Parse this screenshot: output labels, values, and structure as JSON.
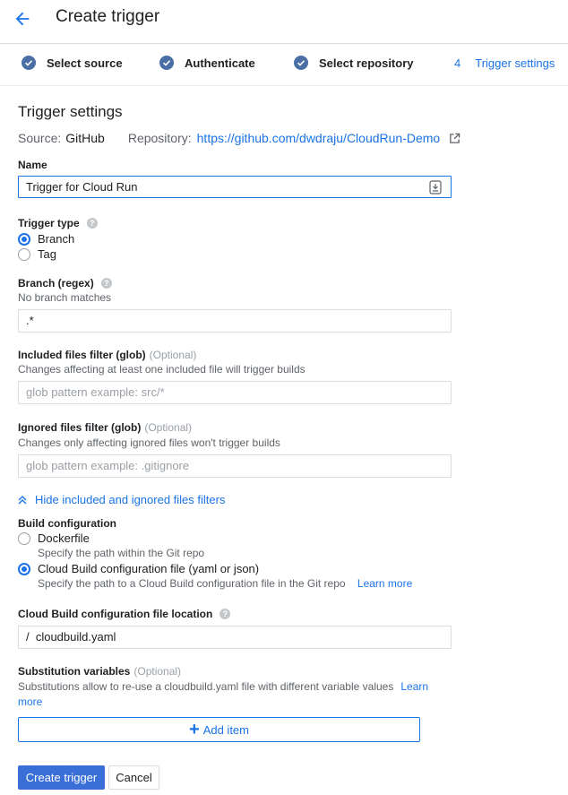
{
  "header": {
    "title": "Create trigger",
    "back_icon": "arrow-back-icon"
  },
  "stepper": {
    "steps": [
      {
        "label": "Select source",
        "state": "done"
      },
      {
        "label": "Authenticate",
        "state": "done"
      },
      {
        "label": "Select repository",
        "state": "done"
      },
      {
        "number": "4",
        "label": "Trigger settings",
        "state": "active"
      }
    ]
  },
  "main": {
    "section_title": "Trigger settings",
    "source_label": "Source:",
    "source_value": "GitHub",
    "repository_label": "Repository:",
    "repository_url": "https://github.com/dwdraju/CloudRun-Demo",
    "name": {
      "label": "Name",
      "value": "Trigger for Cloud Run"
    },
    "trigger_type": {
      "label": "Trigger type",
      "options": [
        "Branch",
        "Tag"
      ],
      "selected": "Branch"
    },
    "branch": {
      "label": "Branch (regex)",
      "hint": "No branch matches",
      "value": ".*"
    },
    "included_files": {
      "label": "Included files filter (glob)",
      "optional": "(Optional)",
      "hint": "Changes affecting at least one included file will trigger builds",
      "placeholder": "glob pattern example: src/*"
    },
    "ignored_files": {
      "label": "Ignored files filter (glob)",
      "optional": "(Optional)",
      "hint": "Changes only affecting ignored files won't trigger builds",
      "placeholder": "glob pattern example: .gitignore"
    },
    "hide_filters_link": "Hide included and ignored files filters",
    "build_config": {
      "label": "Build configuration",
      "options": [
        {
          "label": "Dockerfile",
          "hint": "Specify the path within the Git repo"
        },
        {
          "label": "Cloud Build configuration file (yaml or json)",
          "hint": "Specify the path to a Cloud Build configuration file in the Git repo",
          "link": "Learn more"
        }
      ],
      "selected": "Cloud Build configuration file (yaml or json)"
    },
    "config_location": {
      "label": "Cloud Build configuration file location",
      "value": "/  cloudbuild.yaml"
    },
    "substitution": {
      "label": "Substitution variables",
      "optional": "(Optional)",
      "hint": "Substitutions allow to re-use a cloudbuild.yaml file with different variable values",
      "link": "Learn more"
    },
    "add_item_label": "Add item",
    "create_button": "Create trigger",
    "cancel_button": "Cancel"
  },
  "colors": {
    "accent": "#1a73e8",
    "primary_button": "#3b6fd8",
    "step_check": "#4a6fa5"
  }
}
